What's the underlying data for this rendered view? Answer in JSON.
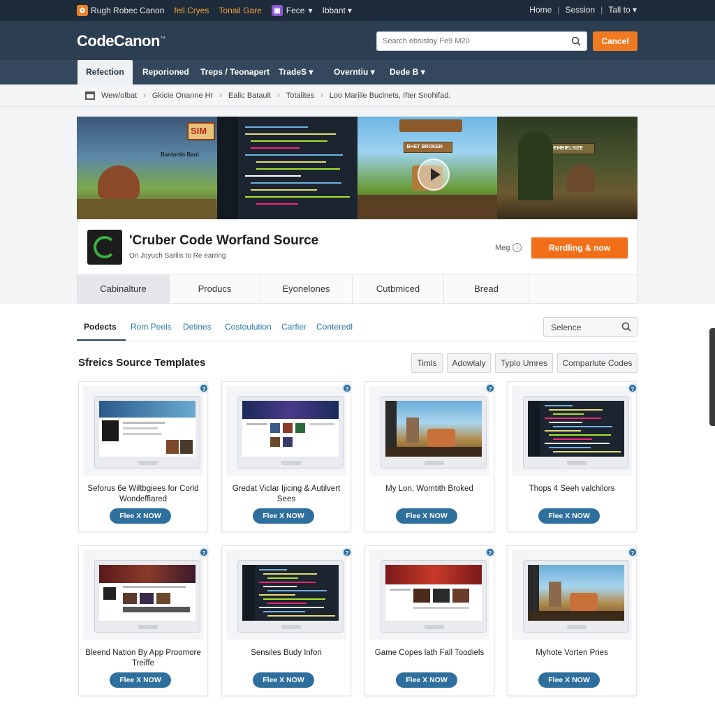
{
  "topbar": {
    "brand": "Rugh Robec Canon",
    "link1": "fell Cryes",
    "link2": "Tonail Gare",
    "link3": "Fece",
    "link4": "Ibbant",
    "right": [
      "Home",
      "Session",
      "Tall to"
    ]
  },
  "header": {
    "logo": "CodeCanon",
    "logo_mark": "™",
    "search_placeholder": "Search ebsistoy Fe9 M20",
    "cancel_label": "Cancel"
  },
  "nav": {
    "items": [
      "Refection",
      "Reporioned",
      "Treps / Teonapert",
      "TradeS",
      "Overntiu",
      "Dede B"
    ]
  },
  "breadcrumb": [
    "Wew/olbat",
    "Gkicie Onanne Hr",
    "Ealic Batault",
    "Totalites",
    "Loo Mariile Buclnets, Ifter Snohifad."
  ],
  "banner": {
    "panel1_tag": "SIM",
    "panel1_caption": "Bantartio Bani",
    "panel3_tag": "BHET BROKEN",
    "panel4_tag": "SEMBIELSIZE"
  },
  "product": {
    "title": "'Cruber Code Worfand Source",
    "subtitle": "On Joyuch Sarliis to Re earring",
    "meg_label": "Meg",
    "cta_label": "Rerdling & now"
  },
  "subtabs": [
    "Cabinalture",
    "Producs",
    "Eyonelones",
    "Cutbmiced",
    "Bread"
  ],
  "content_tabs": [
    "Podects",
    "Rom Peels",
    "Detines",
    "Costoulution",
    "Carfier",
    "Conteredl"
  ],
  "select_label": "Selence",
  "section_title": "Sfreics Source Templates",
  "filters": [
    "Timls",
    "Adowlaly",
    "Typlo Umres",
    "Comparlute Codes"
  ],
  "cards": [
    {
      "title": "Seforus 6e Wiltbgiees for Corld Wondeffiared",
      "button": "Flee X NOW",
      "screen": "web"
    },
    {
      "title": "Gredat Viclar Ijicing & Autilvert Sees",
      "button": "Flee X NOW",
      "screen": "game-web"
    },
    {
      "title": "My Lon, Womtith Broked",
      "button": "Flee X NOW",
      "screen": "game"
    },
    {
      "title": "Thops 4 Seeh valchilors",
      "button": "Flee X NOW",
      "screen": "code"
    },
    {
      "title": "Bleend Nation By App Proomore Treiffe",
      "button": "Flee X NOW",
      "screen": "web-dark"
    },
    {
      "title": "Sensiles Budy Infori",
      "button": "Flee X NOW",
      "screen": "code"
    },
    {
      "title": "Game Copes lath Fall Toodiels",
      "button": "Flee X NOW",
      "screen": "web-red"
    },
    {
      "title": "Myhote Vorten Pries",
      "button": "Flee X NOW",
      "screen": "game"
    }
  ],
  "colors": {
    "topbar": "#1e2b3a",
    "header": "#2c3e52",
    "accent_orange": "#f26f1a",
    "card_button": "#2f6f9e"
  }
}
